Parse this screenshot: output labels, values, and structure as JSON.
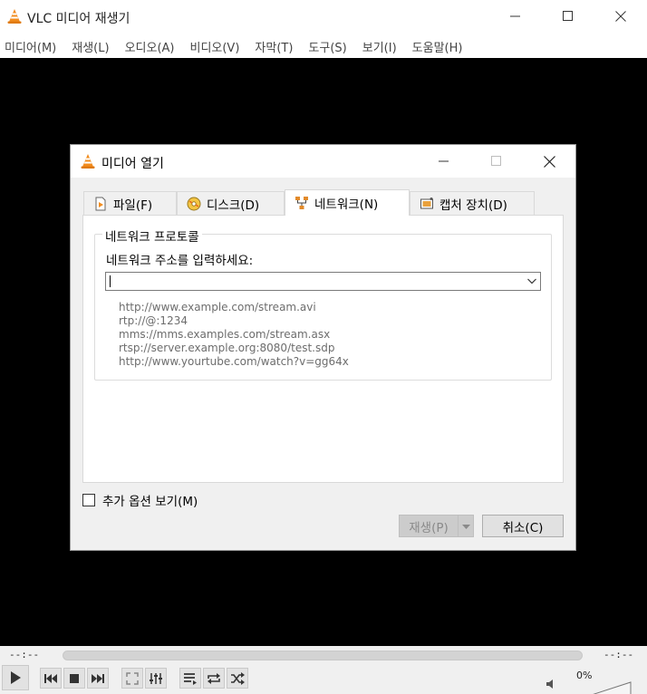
{
  "window": {
    "title": "VLC 미디어 재생기"
  },
  "menu": [
    "미디어(M)",
    "재생(L)",
    "오디오(A)",
    "비디오(V)",
    "자막(T)",
    "도구(S)",
    "보기(I)",
    "도움말(H)"
  ],
  "dialog": {
    "title": "미디어 열기",
    "tabs": [
      {
        "label": "파일(F)",
        "icon": "file-icon"
      },
      {
        "label": "디스크(D)",
        "icon": "disc-icon"
      },
      {
        "label": "네트워크(N)",
        "icon": "network-icon",
        "active": true
      },
      {
        "label": "캡처 장치(D)",
        "icon": "capture-device-icon"
      }
    ],
    "network": {
      "group_title": "네트워크 프로토콜",
      "address_label": "네트워크 주소를 입력하세요:",
      "address_value": "",
      "examples": [
        "http://www.example.com/stream.avi",
        "rtp://@:1234",
        "mms://mms.examples.com/stream.asx",
        "rtsp://server.example.org:8080/test.sdp",
        "http://www.yourtube.com/watch?v=gg64x"
      ]
    },
    "more_options_label": "추가 옵션 보기(M)",
    "more_options_checked": false,
    "play_label": "재생(P)",
    "cancel_label": "취소(C)"
  },
  "player": {
    "elapsed": "--:--",
    "remaining": "--:--",
    "volume": "0%"
  },
  "colors": {
    "video_background": "#000000",
    "vlc_orange": "#f28c1e"
  }
}
